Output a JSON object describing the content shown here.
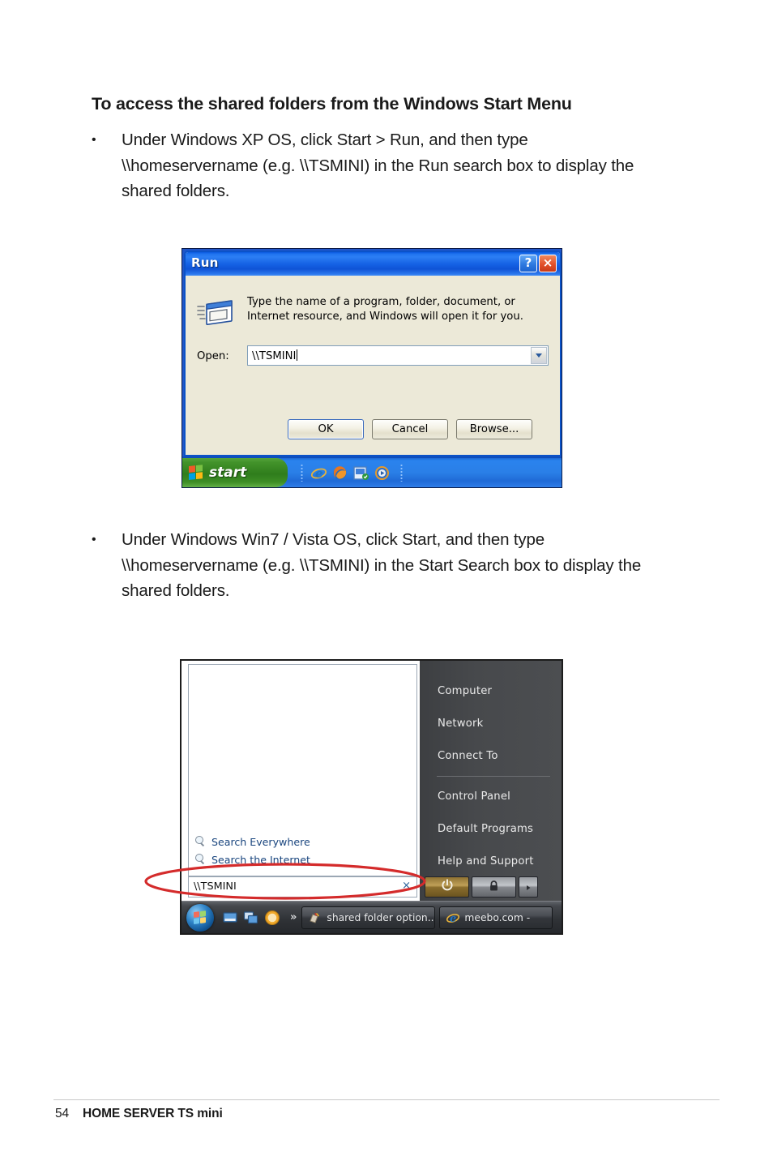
{
  "document": {
    "heading": "To access the shared folders from the Windows Start Menu",
    "bullets": [
      {
        "mark": "•",
        "text": "Under Windows XP OS, click Start > Run, and then type \\\\homeservername (e.g. \\\\TSMINI) in the Run search box to display the shared folders."
      },
      {
        "mark": "•",
        "text": "Under Windows Win7 / Vista OS, click Start, and then type \\\\homeservername (e.g. \\\\TSMINI) in the Start Search box to display the shared folders."
      }
    ],
    "footer": {
      "page_number": "54",
      "title": "HOME SERVER TS mini"
    }
  },
  "xp_run_screenshot": {
    "title": "Run",
    "titlebar_buttons": {
      "help": "?",
      "close": "×"
    },
    "prompt": "Type the name of a program, folder, document, or Internet resource, and Windows will open it for you.",
    "open_label": "Open:",
    "open_value": "\\\\TSMINI",
    "buttons": {
      "ok": "OK",
      "cancel": "Cancel",
      "browse": "Browse..."
    },
    "taskbar": {
      "start_label": "start",
      "quick_launch": [
        "internet-explorer-icon",
        "firefox-icon",
        "outlook-express-icon",
        "windows-media-player-icon"
      ]
    },
    "colors": {
      "titlebar_blue": "#1461e4",
      "dialog_face": "#ece9d8",
      "start_green": "#2f7d1c",
      "taskbar_blue": "#2a7fe7",
      "close_red": "#e2502a"
    }
  },
  "vista_start_screenshot": {
    "right_panel_items": [
      "Computer",
      "Network",
      "Connect To",
      "Control Panel",
      "Default Programs",
      "Help and Support"
    ],
    "separator_after_index": 2,
    "search_links": [
      {
        "icon": "magnifier-icon",
        "label": "Search Everywhere"
      },
      {
        "icon": "magnifier-icon",
        "label": "Search the Internet"
      }
    ],
    "search_box": {
      "value": "\\\\TSMINI",
      "clear_label": "×"
    },
    "power_buttons": [
      {
        "name": "shutdown-button",
        "icon": "power-icon"
      },
      {
        "name": "lock-button",
        "icon": "lock-icon"
      },
      {
        "name": "more-options-button",
        "icon": "triangle-right-icon"
      }
    ],
    "taskbar": {
      "orb": "windows-orb-icon",
      "quick_launch": [
        "show-desktop-icon",
        "switch-windows-icon",
        "media-center-icon"
      ],
      "overflow_label": "»",
      "tasks": [
        {
          "icon": "explorer-icon",
          "label": "shared folder option..."
        },
        {
          "icon": "internet-explorer-icon",
          "label": "meebo.com -"
        }
      ]
    },
    "annotation": {
      "shape": "red-ellipse",
      "color": "#d42b2b"
    },
    "colors": {
      "right_panel_gray": "#47494c",
      "taskbar_dark": "#303337",
      "link_blue": "#19457e",
      "power_amber": "#c0a058"
    }
  }
}
